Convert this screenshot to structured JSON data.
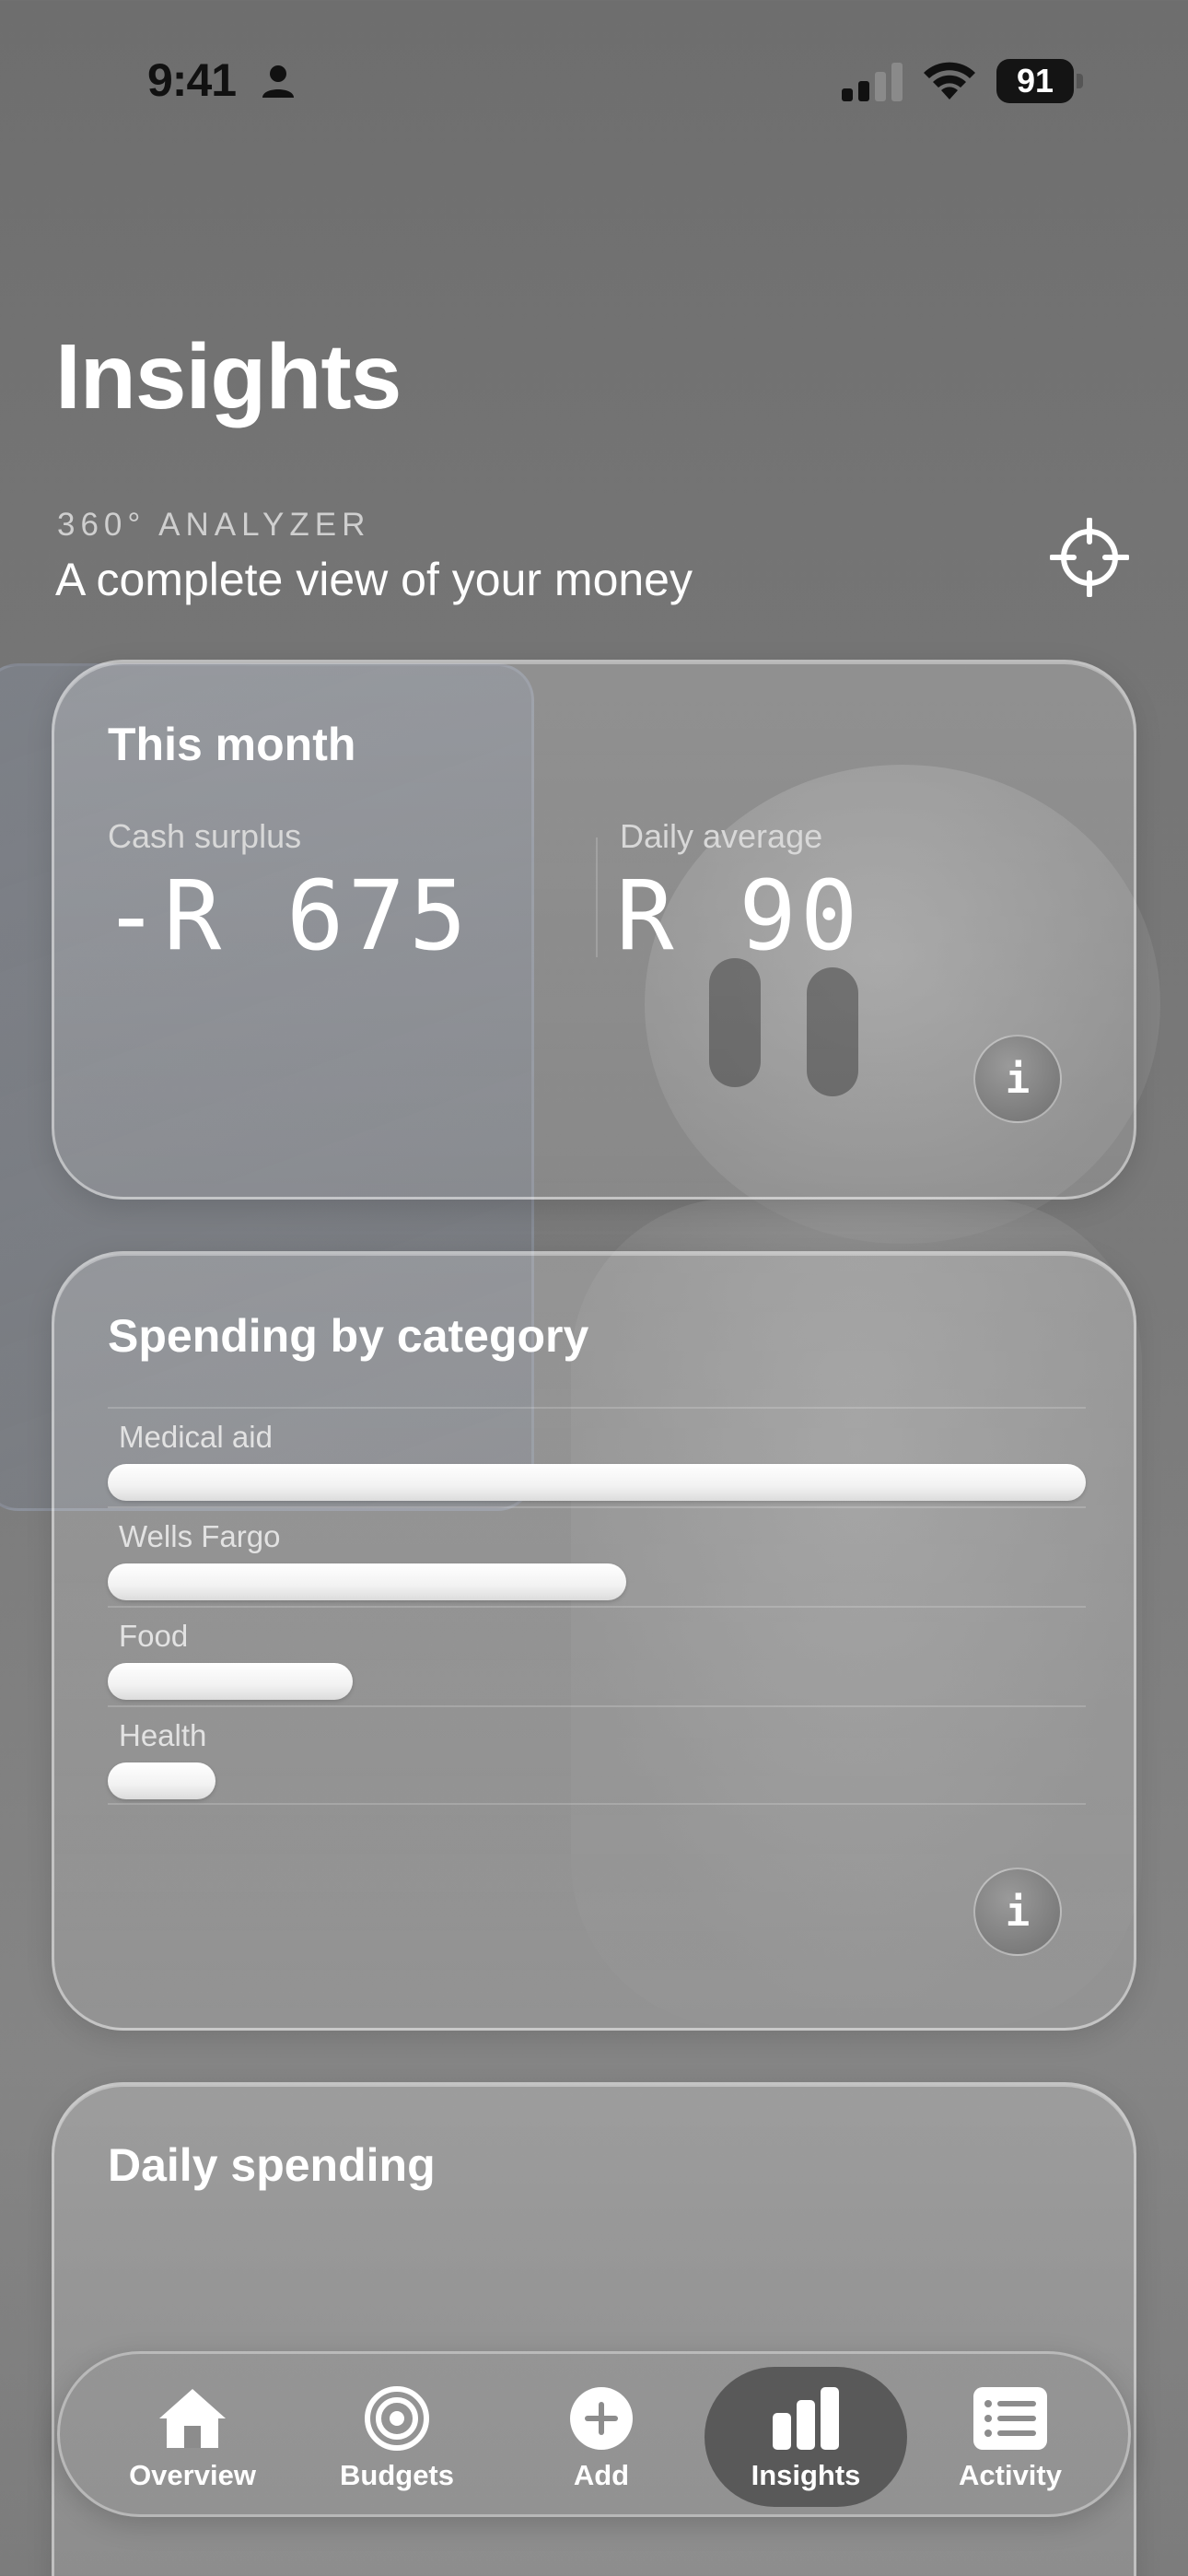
{
  "status_bar": {
    "time": "9:41",
    "battery": "91"
  },
  "page": {
    "title": "Insights"
  },
  "analyzer": {
    "kicker": "360° ANALYZER",
    "subtitle": "A complete view of your money"
  },
  "this_month": {
    "title": "This month",
    "cash_surplus_label": "Cash surplus",
    "cash_surplus_value": "-R 675",
    "daily_average_label": "Daily average",
    "daily_average_value": "R 90",
    "info_label": "i"
  },
  "spending_by_category": {
    "title": "Spending by category",
    "info_label": "i",
    "categories": [
      {
        "label": "Medical aid",
        "fraction": 1.0
      },
      {
        "label": "Wells Fargo",
        "fraction": 0.53
      },
      {
        "label": "Food",
        "fraction": 0.25
      },
      {
        "label": "Health",
        "fraction": 0.11
      }
    ]
  },
  "daily_spending": {
    "title": "Daily spending"
  },
  "tab_bar": {
    "tabs": [
      {
        "label": "Overview",
        "icon": "house-icon"
      },
      {
        "label": "Budgets",
        "icon": "target-icon"
      },
      {
        "label": "Add",
        "icon": "plus-circle-icon"
      },
      {
        "label": "Insights",
        "icon": "bar-chart-icon",
        "active": true
      },
      {
        "label": "Activity",
        "icon": "list-icon"
      }
    ]
  }
}
